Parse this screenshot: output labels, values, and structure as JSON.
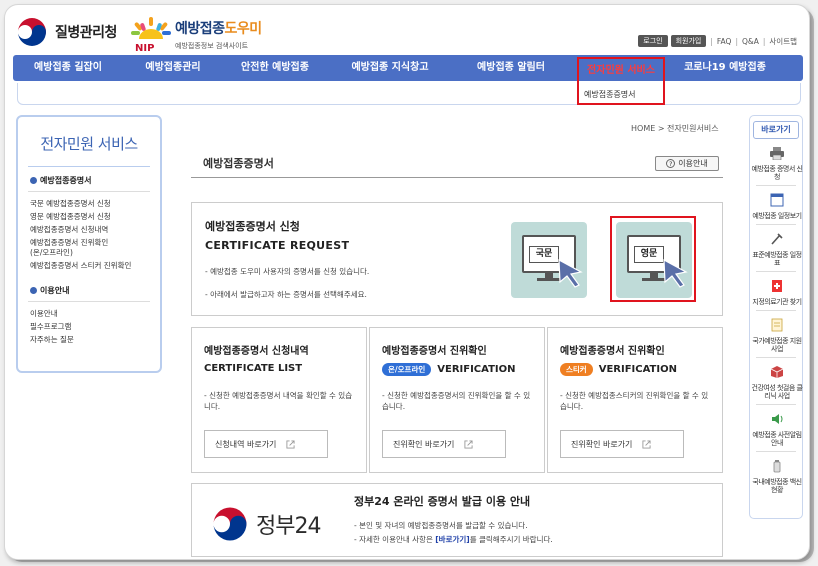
{
  "header": {
    "kdca_name": "질병관리청",
    "site_name_main": "예방접종",
    "site_name_accent": "도우미",
    "site_subtitle": "예방접종정보 검색사이트",
    "nip_text": "NIP",
    "top_links": {
      "login": "로그인",
      "signup": "회원가입",
      "faq": "FAQ",
      "qa": "Q&A",
      "sitemap": "사이트맵"
    }
  },
  "gnb": {
    "items": [
      {
        "label": "예방접종 길잡이"
      },
      {
        "label": "예방접종관리"
      },
      {
        "label": "안전한 예방접종"
      },
      {
        "label": "예방접종 지식창고"
      },
      {
        "label": "예방접종 알림터"
      },
      {
        "label": "전자민원 서비스"
      },
      {
        "label": "코로나19 예방접종"
      }
    ],
    "active_submenu": "예방접종증명서"
  },
  "lnb": {
    "title": "전자민원 서비스",
    "section1": "예방접종증명서",
    "items1": [
      "국문 예방접종증명서 신청",
      "영문 예방접종증명서 신청",
      "예방접종증명서 신청내역",
      "예방접종증명서 진위확인",
      "(온/오프라인)",
      "예방접종증명서 스티커 진위확인"
    ],
    "section2": "이용안내",
    "items2": [
      "이용안내",
      "필수프로그램",
      "자주하는 질문"
    ]
  },
  "content": {
    "breadcrumb": "HOME > 전자민원서비스",
    "page_title": "예방접종증명서",
    "help_button": "이용안내",
    "help_q": "?",
    "request": {
      "title_ko": "예방접종증명서 신청",
      "title_en": "CERTIFICATE REQUEST",
      "desc1": "- 예방접종 도우미 사용자의 증명서를 신청 있습니다.",
      "desc2": "- 아래에서 발급하고자 하는 증명서를 선택해주세요.",
      "korean_label": "국문",
      "english_label": "영문"
    },
    "list": {
      "title_ko": "예방접종증명서 신청내역",
      "title_en": "CERTIFICATE LIST",
      "desc": "- 신청한 예방접종증명서 내역을 확인할 수 있습니다.",
      "button": "신청내역 바로가기"
    },
    "verify_online": {
      "title_ko": "예방접종증명서 진위확인",
      "pill": "온/오프라인",
      "title_en": "VERIFICATION",
      "desc": "- 신청한 예방접종증명서의 진위확인을 할 수 있습니다.",
      "button": "진위확인 바로가기"
    },
    "verify_sticker": {
      "title_ko": "예방접종증명서 진위확인",
      "pill": "스티커",
      "title_en": "VERIFICATION",
      "desc": "- 신청한 예방접종스티커의 진위확인을 할 수 있습니다.",
      "button": "진위확인 바로가기"
    },
    "gov24": {
      "logo_text": "정부24",
      "title": "정부24 온라인 증명서 발급 이용 안내",
      "desc1": "- 본인 및 자녀의 예방접종증명서를 발급할 수 있습니다.",
      "desc2_pre": "- 자세한 이용안내 사항은 ",
      "desc2_link": "[바로가기]",
      "desc2_post": "를 클릭해주시기 바랍니다."
    }
  },
  "quick": {
    "title": "바로가기",
    "items": [
      {
        "label": "예방접종 증명서 신청",
        "icon": "printer-icon"
      },
      {
        "label": "예방접종 일정보기",
        "icon": "calendar-icon"
      },
      {
        "label": "표준예방접종 일정표",
        "icon": "syringe-icon"
      },
      {
        "label": "지정의료기관 찾기",
        "icon": "hospital-cross-icon"
      },
      {
        "label": "국가예방접종 지원사업",
        "icon": "document-icon"
      },
      {
        "label": "건강여성 첫걸음 클리닉 사업",
        "icon": "box-icon"
      },
      {
        "label": "예방접종 사전알림안내",
        "icon": "speaker-icon"
      },
      {
        "label": "국내예방접종 백신현황",
        "icon": "vaccine-icon"
      }
    ]
  },
  "colors": {
    "nav_blue": "#4b6fc5",
    "highlight_red": "#e0141e",
    "pill_blue": "#2f6fd6",
    "pill_orange": "#ef7f22",
    "tile_green": "#bfdbd8"
  }
}
